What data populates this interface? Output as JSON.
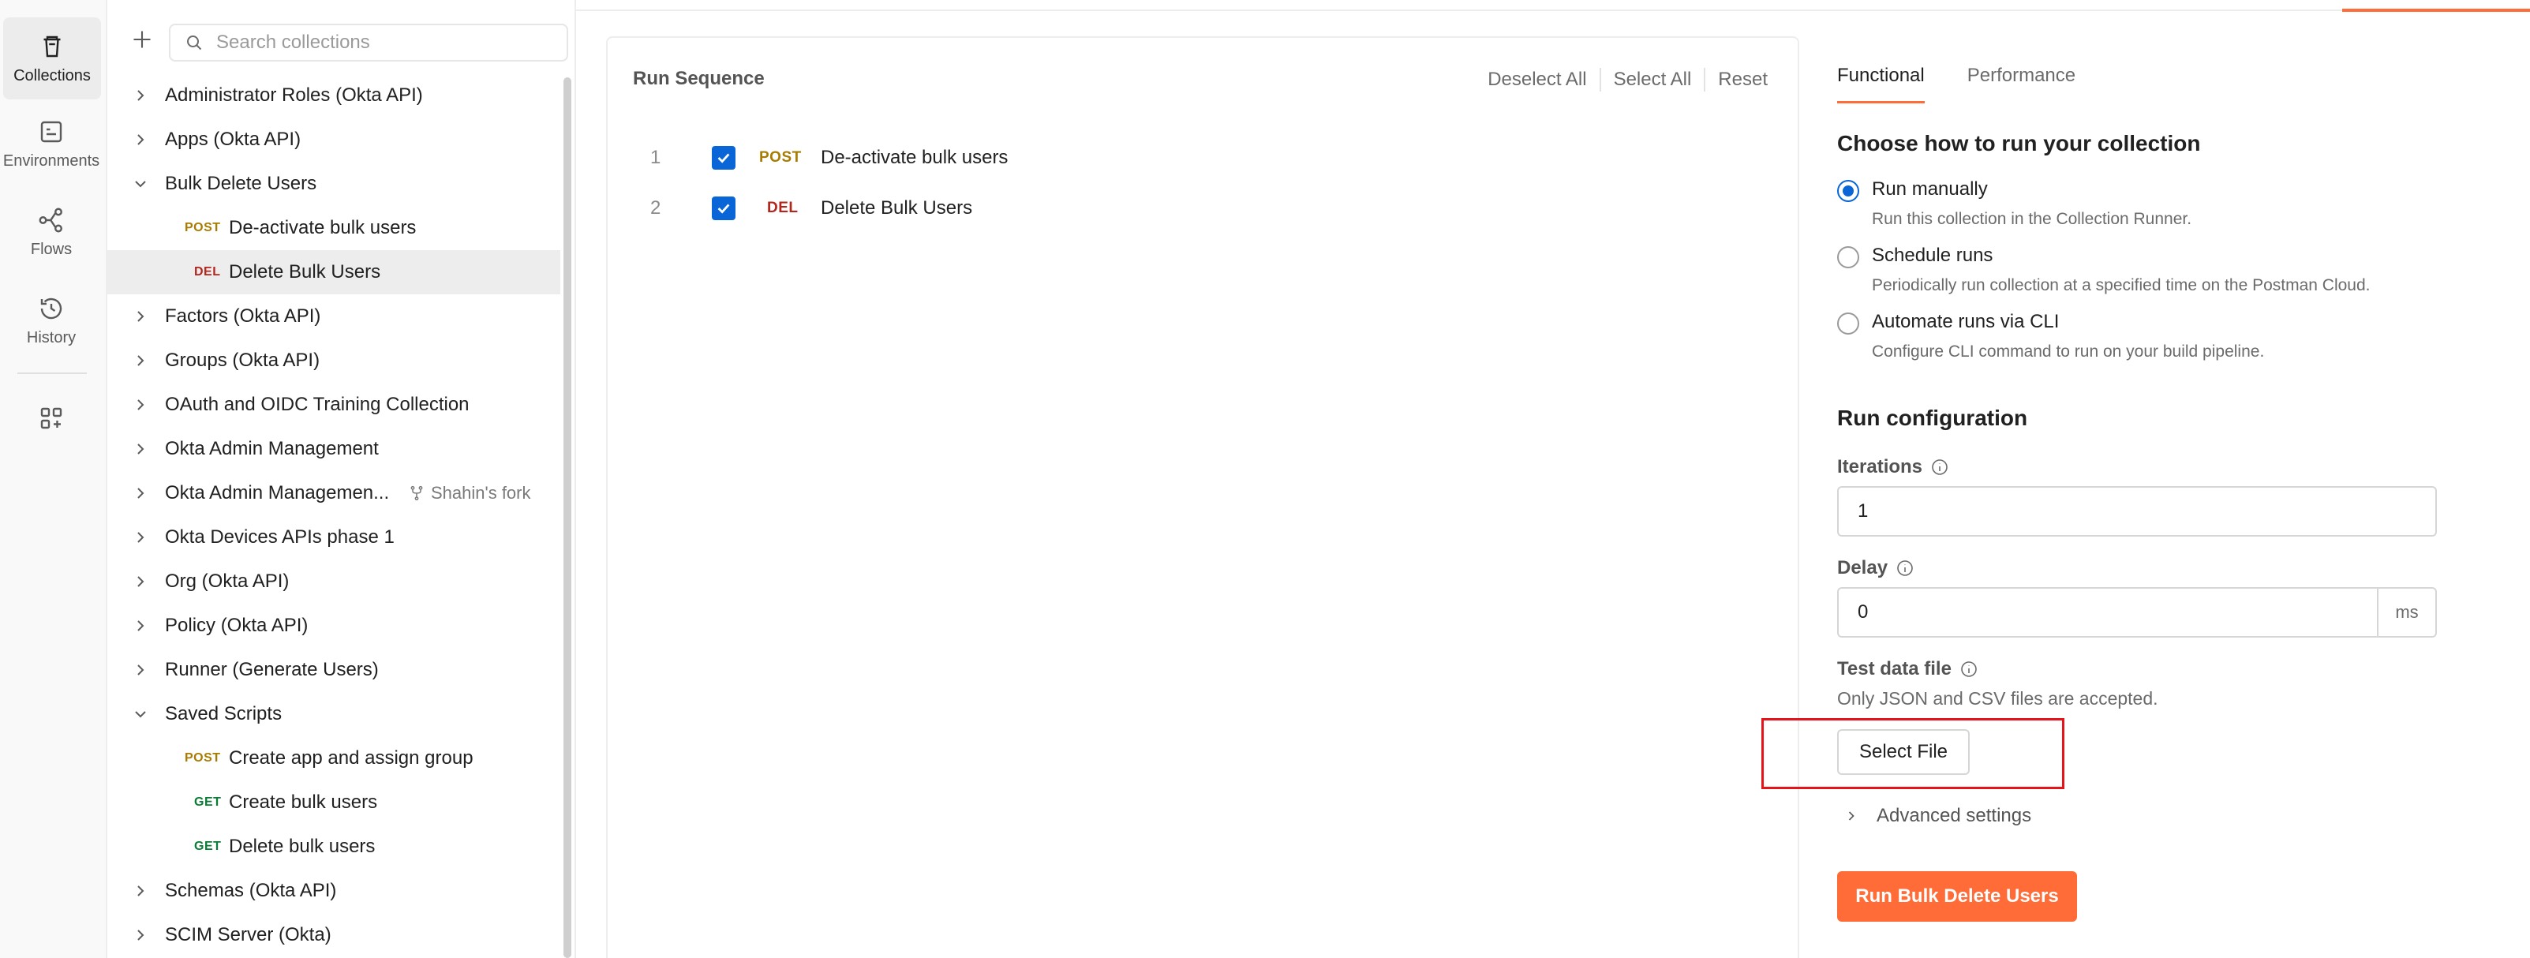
{
  "rail": {
    "items": [
      {
        "label": "Collections",
        "icon": "trash-can-collection-icon",
        "active": true
      },
      {
        "label": "Environments",
        "icon": "environment-icon",
        "active": false
      },
      {
        "label": "Flows",
        "icon": "flows-icon",
        "active": false
      },
      {
        "label": "History",
        "icon": "history-icon",
        "active": false
      }
    ],
    "extra_icon": "add-workspace-icon"
  },
  "sidebar": {
    "search_placeholder": "Search collections",
    "tree": [
      {
        "type": "folder",
        "label": "Administrator Roles (Okta API)",
        "expanded": false
      },
      {
        "type": "folder",
        "label": "Apps (Okta API)",
        "expanded": false
      },
      {
        "type": "folder",
        "label": "Bulk Delete Users",
        "expanded": true
      },
      {
        "type": "request",
        "method": "POST",
        "label": "De-activate bulk users"
      },
      {
        "type": "request",
        "method": "DEL",
        "label": "Delete Bulk Users",
        "selected": true
      },
      {
        "type": "folder",
        "label": "Factors (Okta API)",
        "expanded": false
      },
      {
        "type": "folder",
        "label": "Groups (Okta API)",
        "expanded": false
      },
      {
        "type": "folder",
        "label": "OAuth and OIDC Training Collection",
        "expanded": false
      },
      {
        "type": "folder",
        "label": "Okta Admin Management",
        "expanded": false
      },
      {
        "type": "folder",
        "label": "Okta Admin Managemen...",
        "expanded": false,
        "fork": "Shahin's fork"
      },
      {
        "type": "folder",
        "label": "Okta Devices APIs phase 1",
        "expanded": false
      },
      {
        "type": "folder",
        "label": "Org (Okta API)",
        "expanded": false
      },
      {
        "type": "folder",
        "label": "Policy (Okta API)",
        "expanded": false
      },
      {
        "type": "folder",
        "label": "Runner (Generate Users)",
        "expanded": false
      },
      {
        "type": "folder",
        "label": "Saved Scripts",
        "expanded": true
      },
      {
        "type": "request",
        "method": "POST",
        "label": "Create app and assign group"
      },
      {
        "type": "request",
        "method": "GET",
        "label": "Create bulk users"
      },
      {
        "type": "request",
        "method": "GET",
        "label": "Delete bulk users"
      },
      {
        "type": "folder",
        "label": "Schemas (Okta API)",
        "expanded": false
      },
      {
        "type": "folder",
        "label": "SCIM Server (Okta)",
        "expanded": false
      }
    ]
  },
  "run_sequence": {
    "title": "Run Sequence",
    "actions": {
      "deselect_all": "Deselect All",
      "select_all": "Select All",
      "reset": "Reset"
    },
    "items": [
      {
        "index": "1",
        "method": "POST",
        "name": "De-activate bulk users",
        "checked": true
      },
      {
        "index": "2",
        "method": "DEL",
        "name": "Delete Bulk Users",
        "checked": true
      }
    ]
  },
  "config": {
    "tabs": [
      {
        "label": "Functional",
        "active": true
      },
      {
        "label": "Performance",
        "active": false
      }
    ],
    "choose_heading": "Choose how to run your collection",
    "run_options": [
      {
        "label": "Run manually",
        "desc": "Run this collection in the Collection Runner.",
        "selected": true
      },
      {
        "label": "Schedule runs",
        "desc": "Periodically run collection at a specified time on the Postman Cloud.",
        "selected": false
      },
      {
        "label": "Automate runs via CLI",
        "desc": "Configure CLI command to run on your build pipeline.",
        "selected": false
      }
    ],
    "run_config_heading": "Run configuration",
    "iterations_label": "Iterations",
    "iterations_value": "1",
    "delay_label": "Delay",
    "delay_value": "0",
    "delay_unit": "ms",
    "test_data_label": "Test data file",
    "test_data_hint": "Only JSON and CSV files are accepted.",
    "select_file_label": "Select File",
    "advanced_label": "Advanced settings",
    "run_button_label": "Run Bulk Delete Users",
    "accent_color": "#ff6c37",
    "checkbox_color": "#0a66d6",
    "highlight_color": "#e5141a"
  }
}
